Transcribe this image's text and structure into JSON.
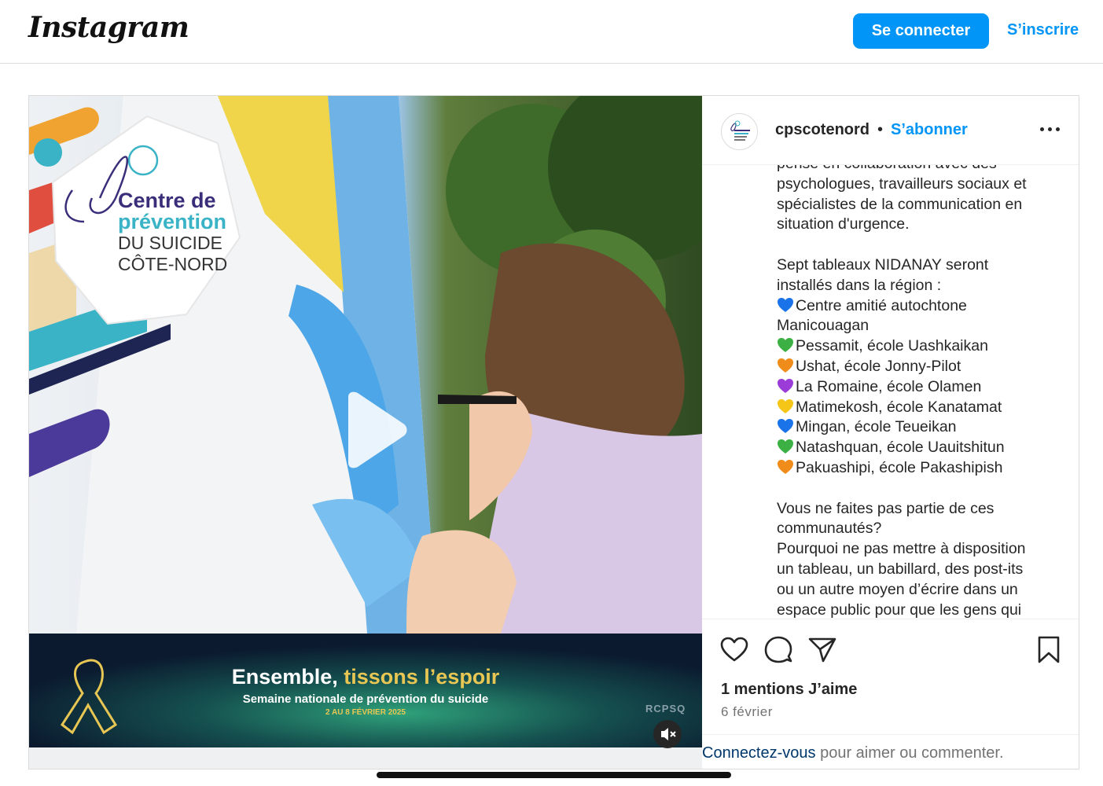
{
  "header": {
    "logo": "Instagram",
    "login_label": "Se connecter",
    "signup_label": "S’inscrire"
  },
  "media": {
    "brand": {
      "line1": "Centre de",
      "line2": "prévention",
      "line3": "DU SUICIDE",
      "line4": "CÔTE-NORD"
    },
    "banner": {
      "title_part1": "Ensemble, ",
      "title_part2": "tissons l’espoir",
      "subtitle": "Semaine nationale de prévention du suicide",
      "dates": "2 AU 8 FÉVRIER 2025",
      "org": "RCPSQ"
    }
  },
  "post": {
    "username": "cpscotenord",
    "separator": "•",
    "follow_label": "S’abonner",
    "caption": {
      "p1": [
        "pensé en collaboration avec des",
        "psychologues, travailleurs sociaux et",
        "spécialistes de la communication en",
        "situation d'urgence."
      ],
      "intro": [
        "Sept tableaux NIDANAY seront",
        "installés dans la région :"
      ],
      "items": [
        {
          "heart": "#1a73e8",
          "text": "Centre amitié autochtone"
        },
        {
          "heart": "",
          "text": "Manicouagan"
        },
        {
          "heart": "#3cb043",
          "text": "Pessamit, école Uashkaikan"
        },
        {
          "heart": "#f08c1a",
          "text": "Ushat, école Jonny-Pilot"
        },
        {
          "heart": "#9b3cd8",
          "text": "La Romaine, école Olamen"
        },
        {
          "heart": "#f5c518",
          "text": "Matimekosh, école Kanatamat"
        },
        {
          "heart": "#1a73e8",
          "text": "Mingan, école Teueikan"
        },
        {
          "heart": "#3cb043",
          "text": "Natashquan, école Uauitshitun"
        },
        {
          "heart": "#f08c1a",
          "text": "Pakuashipi, école Pakashipish"
        }
      ],
      "p3": [
        "Vous ne faites pas partie de ces",
        "communautés?",
        "Pourquoi ne pas mettre à disposition",
        "un tableau, un babillard, des post-its",
        "ou un autre moyen d’écrire dans un",
        "espace public pour que les gens qui"
      ]
    },
    "likes": "1 mentions J’aime",
    "date": "6 février",
    "footer_link": "Connectez-vous",
    "footer_text": " pour aimer ou commenter."
  },
  "icons": [
    "like-icon",
    "comment-icon",
    "share-icon",
    "save-icon",
    "more-icon",
    "play-icon",
    "mute-icon"
  ],
  "colors": {
    "accent": "#0095f6",
    "brand_purple": "#3a2e7a",
    "brand_teal": "#39b3c5",
    "banner_gold": "#e8c653"
  }
}
